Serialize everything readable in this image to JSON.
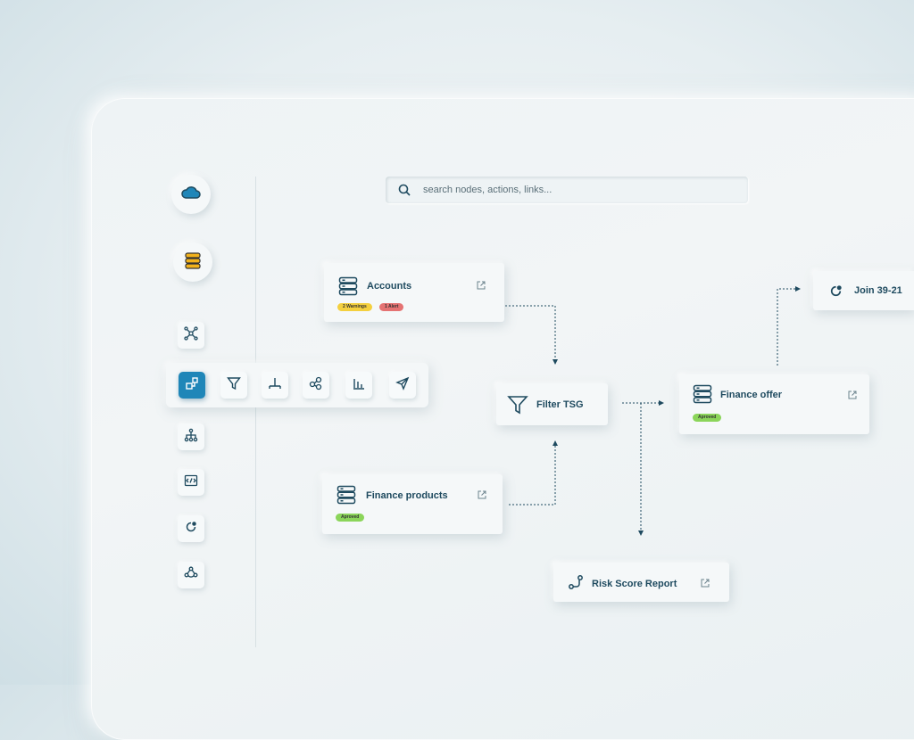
{
  "search": {
    "placeholder": "search nodes, actions, links..."
  },
  "nodes": {
    "accounts": {
      "title": "Accounts",
      "badges": [
        "2 Warnings",
        "1 Alert"
      ]
    },
    "filter": {
      "title": "Filter TSG"
    },
    "finance_products": {
      "title": "Finance products",
      "badges": [
        "Aproved"
      ]
    },
    "finance_offer": {
      "title": "Finance offer",
      "badges": [
        "Aproved"
      ]
    },
    "join": {
      "title": "Join 39-21"
    },
    "risk": {
      "title": "Risk Score Report"
    }
  },
  "colors": {
    "accent": "#1f86b8",
    "text": "#1e4a5f",
    "warning": "#f4d03f",
    "alert": "#e57373",
    "approved": "#8bd55a",
    "db_icon": "#f2b21b"
  },
  "icons": [
    "cloud-icon",
    "database-icon",
    "network-icon",
    "node-link-icon",
    "filter-icon",
    "split-icon",
    "cluster-icon",
    "chart-bars-icon",
    "send-icon",
    "hierarchy-icon",
    "code-icon",
    "refresh-icon",
    "share-icon",
    "search-icon",
    "external-link-icon",
    "table-icon",
    "route-icon"
  ]
}
